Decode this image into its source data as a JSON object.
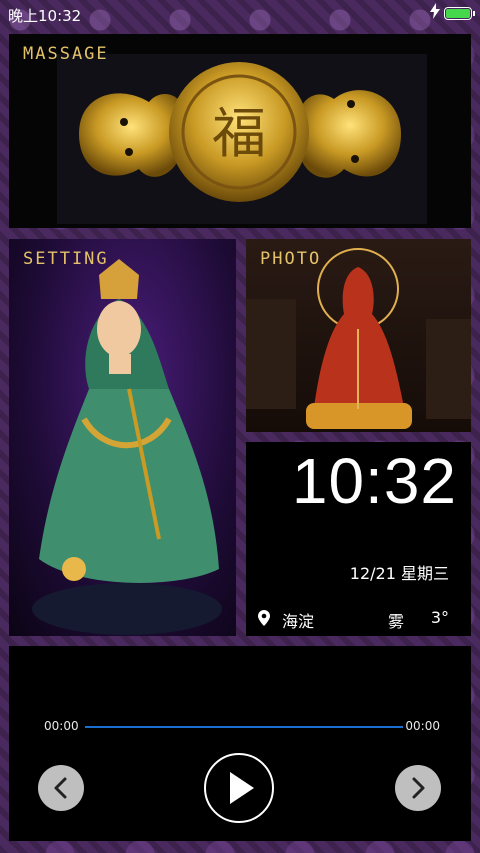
{
  "status_bar": {
    "time": "晚上10:32",
    "battery_level": 1.0
  },
  "tiles": {
    "massage": {
      "label": "MASSAGE"
    },
    "setting": {
      "label": "SETTING"
    },
    "photo": {
      "label": "PHOTO"
    }
  },
  "clock_widget": {
    "time": "10:32",
    "date": "12/21 星期三",
    "location": "海淀",
    "weather": "雾",
    "temperature": "3°"
  },
  "player": {
    "elapsed": "00:00",
    "duration": "00:00",
    "progress": 0,
    "accent_color": "#1b6fd0"
  },
  "colors": {
    "label_gold": "#e4c26a",
    "background": "#4a2a5e",
    "battery": "#46d84c"
  }
}
